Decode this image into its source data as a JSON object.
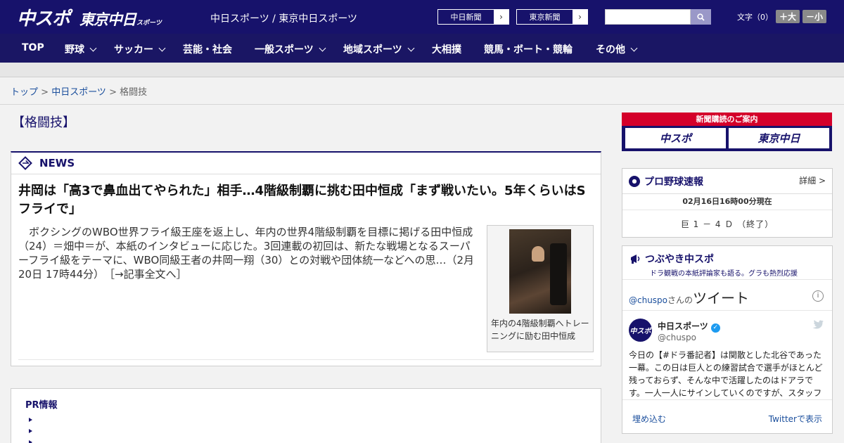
{
  "header": {
    "logo_main": "中スポ",
    "logo_tokyo": "東京中日",
    "logo_sports": "スポーツ",
    "site_links": "中日スポーツ / 東京中日スポーツ",
    "btn_chunichi": "中日新聞",
    "btn_tokyo": "東京新聞",
    "search_placeholder": "",
    "font_label": "文字（0）",
    "font_plus": "＋大",
    "font_minus": "－小"
  },
  "nav": {
    "items": [
      {
        "label": "TOP",
        "dropdown": false
      },
      {
        "label": "野球",
        "dropdown": true
      },
      {
        "label": "サッカー",
        "dropdown": true
      },
      {
        "label": "芸能・社会",
        "dropdown": false
      },
      {
        "label": "一般スポーツ",
        "dropdown": true
      },
      {
        "label": "地域スポーツ",
        "dropdown": true
      },
      {
        "label": "大相撲",
        "dropdown": false
      },
      {
        "label": "競馬・ボート・競輪",
        "dropdown": false
      },
      {
        "label": "その他",
        "dropdown": true
      }
    ]
  },
  "breadcrumb": {
    "top": "トップ",
    "sep": " > ",
    "section": "中日スポーツ",
    "current": "格闘技"
  },
  "page": {
    "title": "【格闘技】"
  },
  "news": {
    "label": "NEWS",
    "headline": "井岡は「高3で鼻血出てやられた」相手…4階級制覇に挑む田中恒成「まず戦いたい。5年くらいはSフライで」",
    "lead": "　ボクシングのWBO世界フライ級王座を返上し、年内の世界4階級制覇を目標に掲げる田中恒成（24）＝畑中＝が、本紙のインタビューに応じた。3回連載の初回は、新たな戦場となるスーパーフライ級をテーマに、WBO同級王者の井岡一翔（30）との対戦や団体統一などへの思…（2月20日 17時44分）　［→記事全文へ］",
    "photo_caption": "年内の4階級制覇へトレーニングに励む田中恒成"
  },
  "pr": {
    "title": "PR情報"
  },
  "sidebar": {
    "subscribe_title": "新聞購読のご案内",
    "subscribe_btn1": "中スポ",
    "subscribe_btn2": "東京中日",
    "baseball_title": "プロ野球速報",
    "baseball_more": "詳細 >",
    "baseball_time": "02月16日16時00分現在",
    "baseball_score": "巨 1 － 4 Ｄ （終了）",
    "tweet_title": "つぶやき中スポ",
    "tweet_sub": "ドラ観戦の本紙評論家も語る。グラも熱烈応援",
    "tweet_handle_link": "@chuspo",
    "tweet_handle_suffix": "さんの",
    "tweet_word": "ツイート",
    "tweet_name": "中日スポーツ",
    "tweet_handle": "@chuspo",
    "tweet_text": "今日の【#ドラ番記者】は関散とした北谷であった一幕。この日は巨人との練習試合で選手がほとんど残っておらず、そんな中で活躍したのはドアラです。一人一人にサインしていくのですが、スタッフ",
    "tweet_embed": "埋め込む",
    "tweet_view": "Twitterで表示"
  }
}
